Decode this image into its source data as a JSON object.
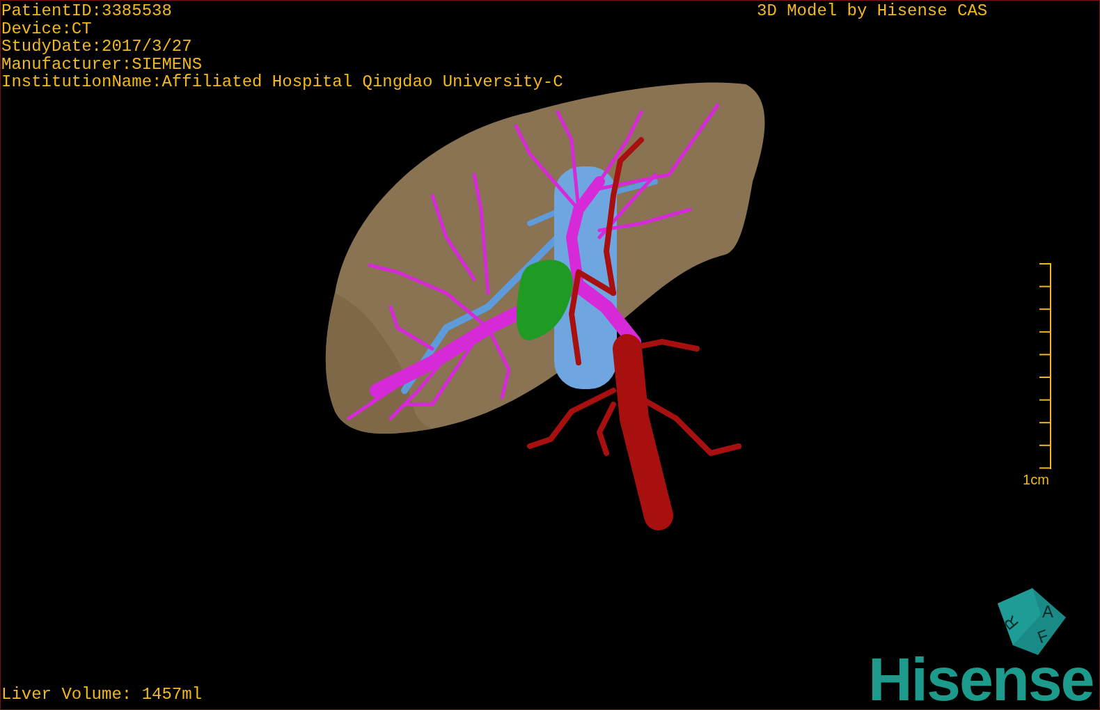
{
  "patient_info": [
    "PatientID:3385538",
    "Device:CT",
    "StudyDate:2017/3/27",
    "Manufacturer:SIEMENS",
    "InstitutionName:Affiliated Hospital Qingdao University-C"
  ],
  "model_title": "3D Model by Hisense CAS",
  "scale_bar": {
    "label": "1cm"
  },
  "liver_volume": "Liver Volume: 1457ml",
  "orientation_cube": {
    "faces": [
      "A",
      "F",
      "R"
    ]
  },
  "logo": "Hisense"
}
